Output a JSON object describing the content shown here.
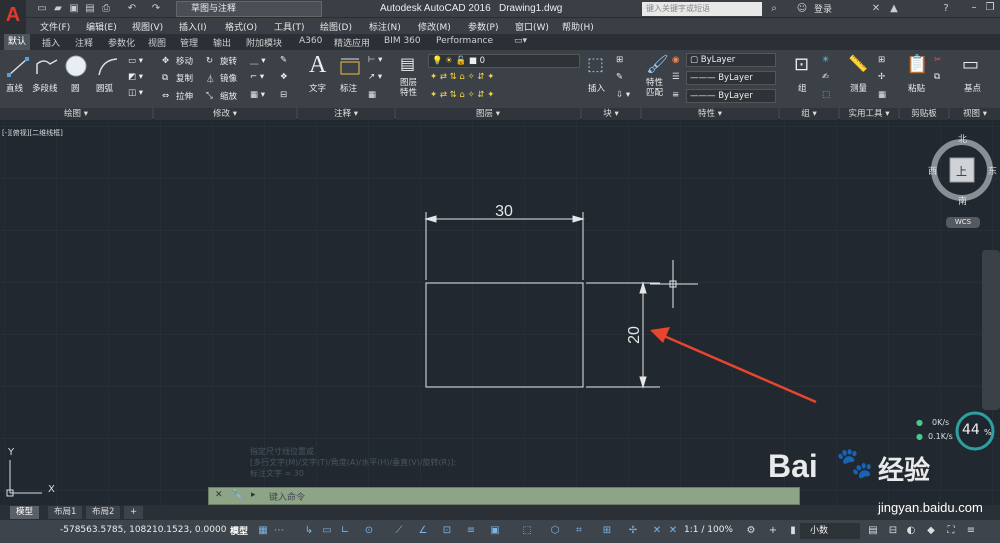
{
  "app": {
    "title": "Autodesk AutoCAD 2016",
    "file": "Drawing1.dwg"
  },
  "workspace": {
    "label": "草图与注释"
  },
  "search": {
    "placeholder": "键入关键字或短语"
  },
  "login": {
    "label": "登录"
  },
  "menus": [
    "文件(F)",
    "编辑(E)",
    "视图(V)",
    "插入(I)",
    "格式(O)",
    "工具(T)",
    "绘图(D)",
    "标注(N)",
    "修改(M)",
    "参数(P)",
    "窗口(W)",
    "帮助(H)"
  ],
  "ribbon_tabs": [
    "默认",
    "插入",
    "注释",
    "参数化",
    "视图",
    "管理",
    "输出",
    "附加模块",
    "A360",
    "精选应用",
    "BIM 360",
    "Performance"
  ],
  "ribbon": {
    "draw": {
      "line": "直线",
      "polyline": "多段线",
      "circle": "圆",
      "arc": "圆弧",
      "panel": "绘图"
    },
    "modify": {
      "move": "移动",
      "rotate": "旋转",
      "copy": "复制",
      "mirror": "镜像",
      "stretch": "拉伸",
      "scale": "缩放",
      "panel": "修改"
    },
    "annotation": {
      "text": "文字",
      "dimension": "标注",
      "panel": "注释"
    },
    "layers": {
      "current": "0",
      "properties": "图层\n特性",
      "panel": "图层"
    },
    "block": {
      "insert": "插入",
      "panel": "块"
    },
    "properties": {
      "match": "特性\n匹配",
      "color": "ByLayer",
      "linetype": "ByLayer",
      "lineweight": "ByLayer",
      "panel": "特性"
    },
    "groups": {
      "group": "组",
      "panel": "组"
    },
    "utilities": {
      "measure": "测量",
      "panel": "实用工具"
    },
    "clipboard": {
      "paste": "粘贴",
      "panel": "剪贴板"
    },
    "view": {
      "base": "基点",
      "panel": "视图"
    }
  },
  "viewport_label": "[-][俯视][二维线框]",
  "drawing": {
    "width_dim": "30",
    "height_dim": "20"
  },
  "viewcube": {
    "north": "北",
    "south": "南",
    "east": "东",
    "west": "西",
    "face": "上",
    "wcs": "WCS"
  },
  "ucs": {
    "x": "X",
    "y": "Y"
  },
  "command": {
    "placeholder": "键入命令",
    "history": [
      "指定尺寸线位置或",
      "[多行文字(M)/文字(T)/角度(A)/水平(H)/垂直(V)/旋转(R)]:",
      "标注文字 = 30"
    ]
  },
  "layout_tabs": [
    "模型",
    "布局1",
    "布局2"
  ],
  "status": {
    "coords": "-578563.5785, 108210.1523, 0.0000",
    "model": "模型",
    "scale": "1:1 / 100%",
    "units": "小数"
  },
  "network": {
    "up": "0K/s",
    "down": "0.1K/s",
    "percent": "44",
    "percent_unit": "%"
  },
  "watermark": {
    "brand": "Bai",
    "brand2": "经验",
    "site": "jingyan.baidu.com"
  },
  "colors": {
    "background": "#212830",
    "accent_red": "#e8452f",
    "geometry": "#e6e6e6"
  }
}
